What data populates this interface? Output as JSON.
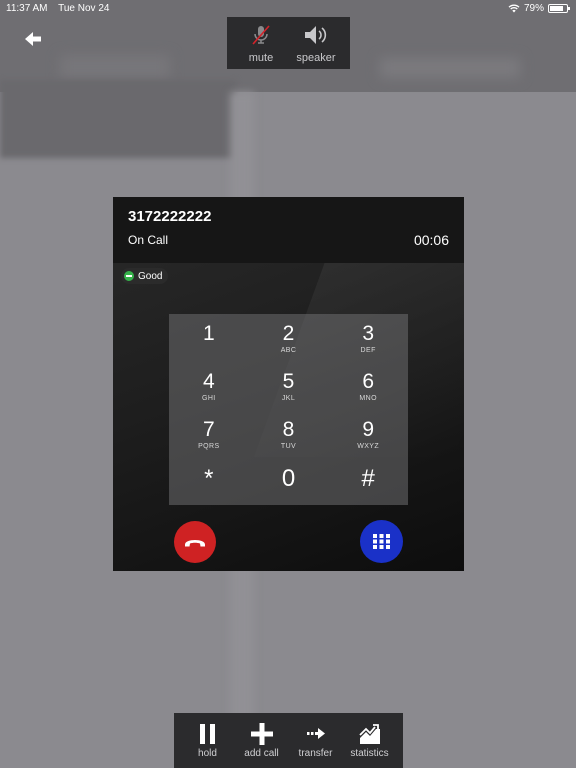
{
  "status": {
    "time": "11:37 AM",
    "date": "Tue Nov 24",
    "battery": "79%",
    "battery_level": 0.79
  },
  "audio": {
    "mute_label": "mute",
    "speaker_label": "speaker"
  },
  "call": {
    "number": "3172222222",
    "state": "On Call",
    "timer": "00:06",
    "quality": "Good"
  },
  "keypad": {
    "keys": [
      {
        "digit": "1",
        "letters": ""
      },
      {
        "digit": "2",
        "letters": "ABC"
      },
      {
        "digit": "3",
        "letters": "DEF"
      },
      {
        "digit": "4",
        "letters": "GHI"
      },
      {
        "digit": "5",
        "letters": "JKL"
      },
      {
        "digit": "6",
        "letters": "MNO"
      },
      {
        "digit": "7",
        "letters": "PQRS"
      },
      {
        "digit": "8",
        "letters": "TUV"
      },
      {
        "digit": "9",
        "letters": "WXYZ"
      },
      {
        "digit": "*",
        "letters": ""
      },
      {
        "digit": "0",
        "letters": ""
      },
      {
        "digit": "#",
        "letters": ""
      }
    ]
  },
  "toolbar": {
    "hold_label": "hold",
    "add_call_label": "add call",
    "transfer_label": "transfer",
    "statistics_label": "statistics"
  },
  "colors": {
    "hangup": "#cf2223",
    "keypad_toggle": "#1a31c8",
    "quality_good": "#35b24a"
  }
}
